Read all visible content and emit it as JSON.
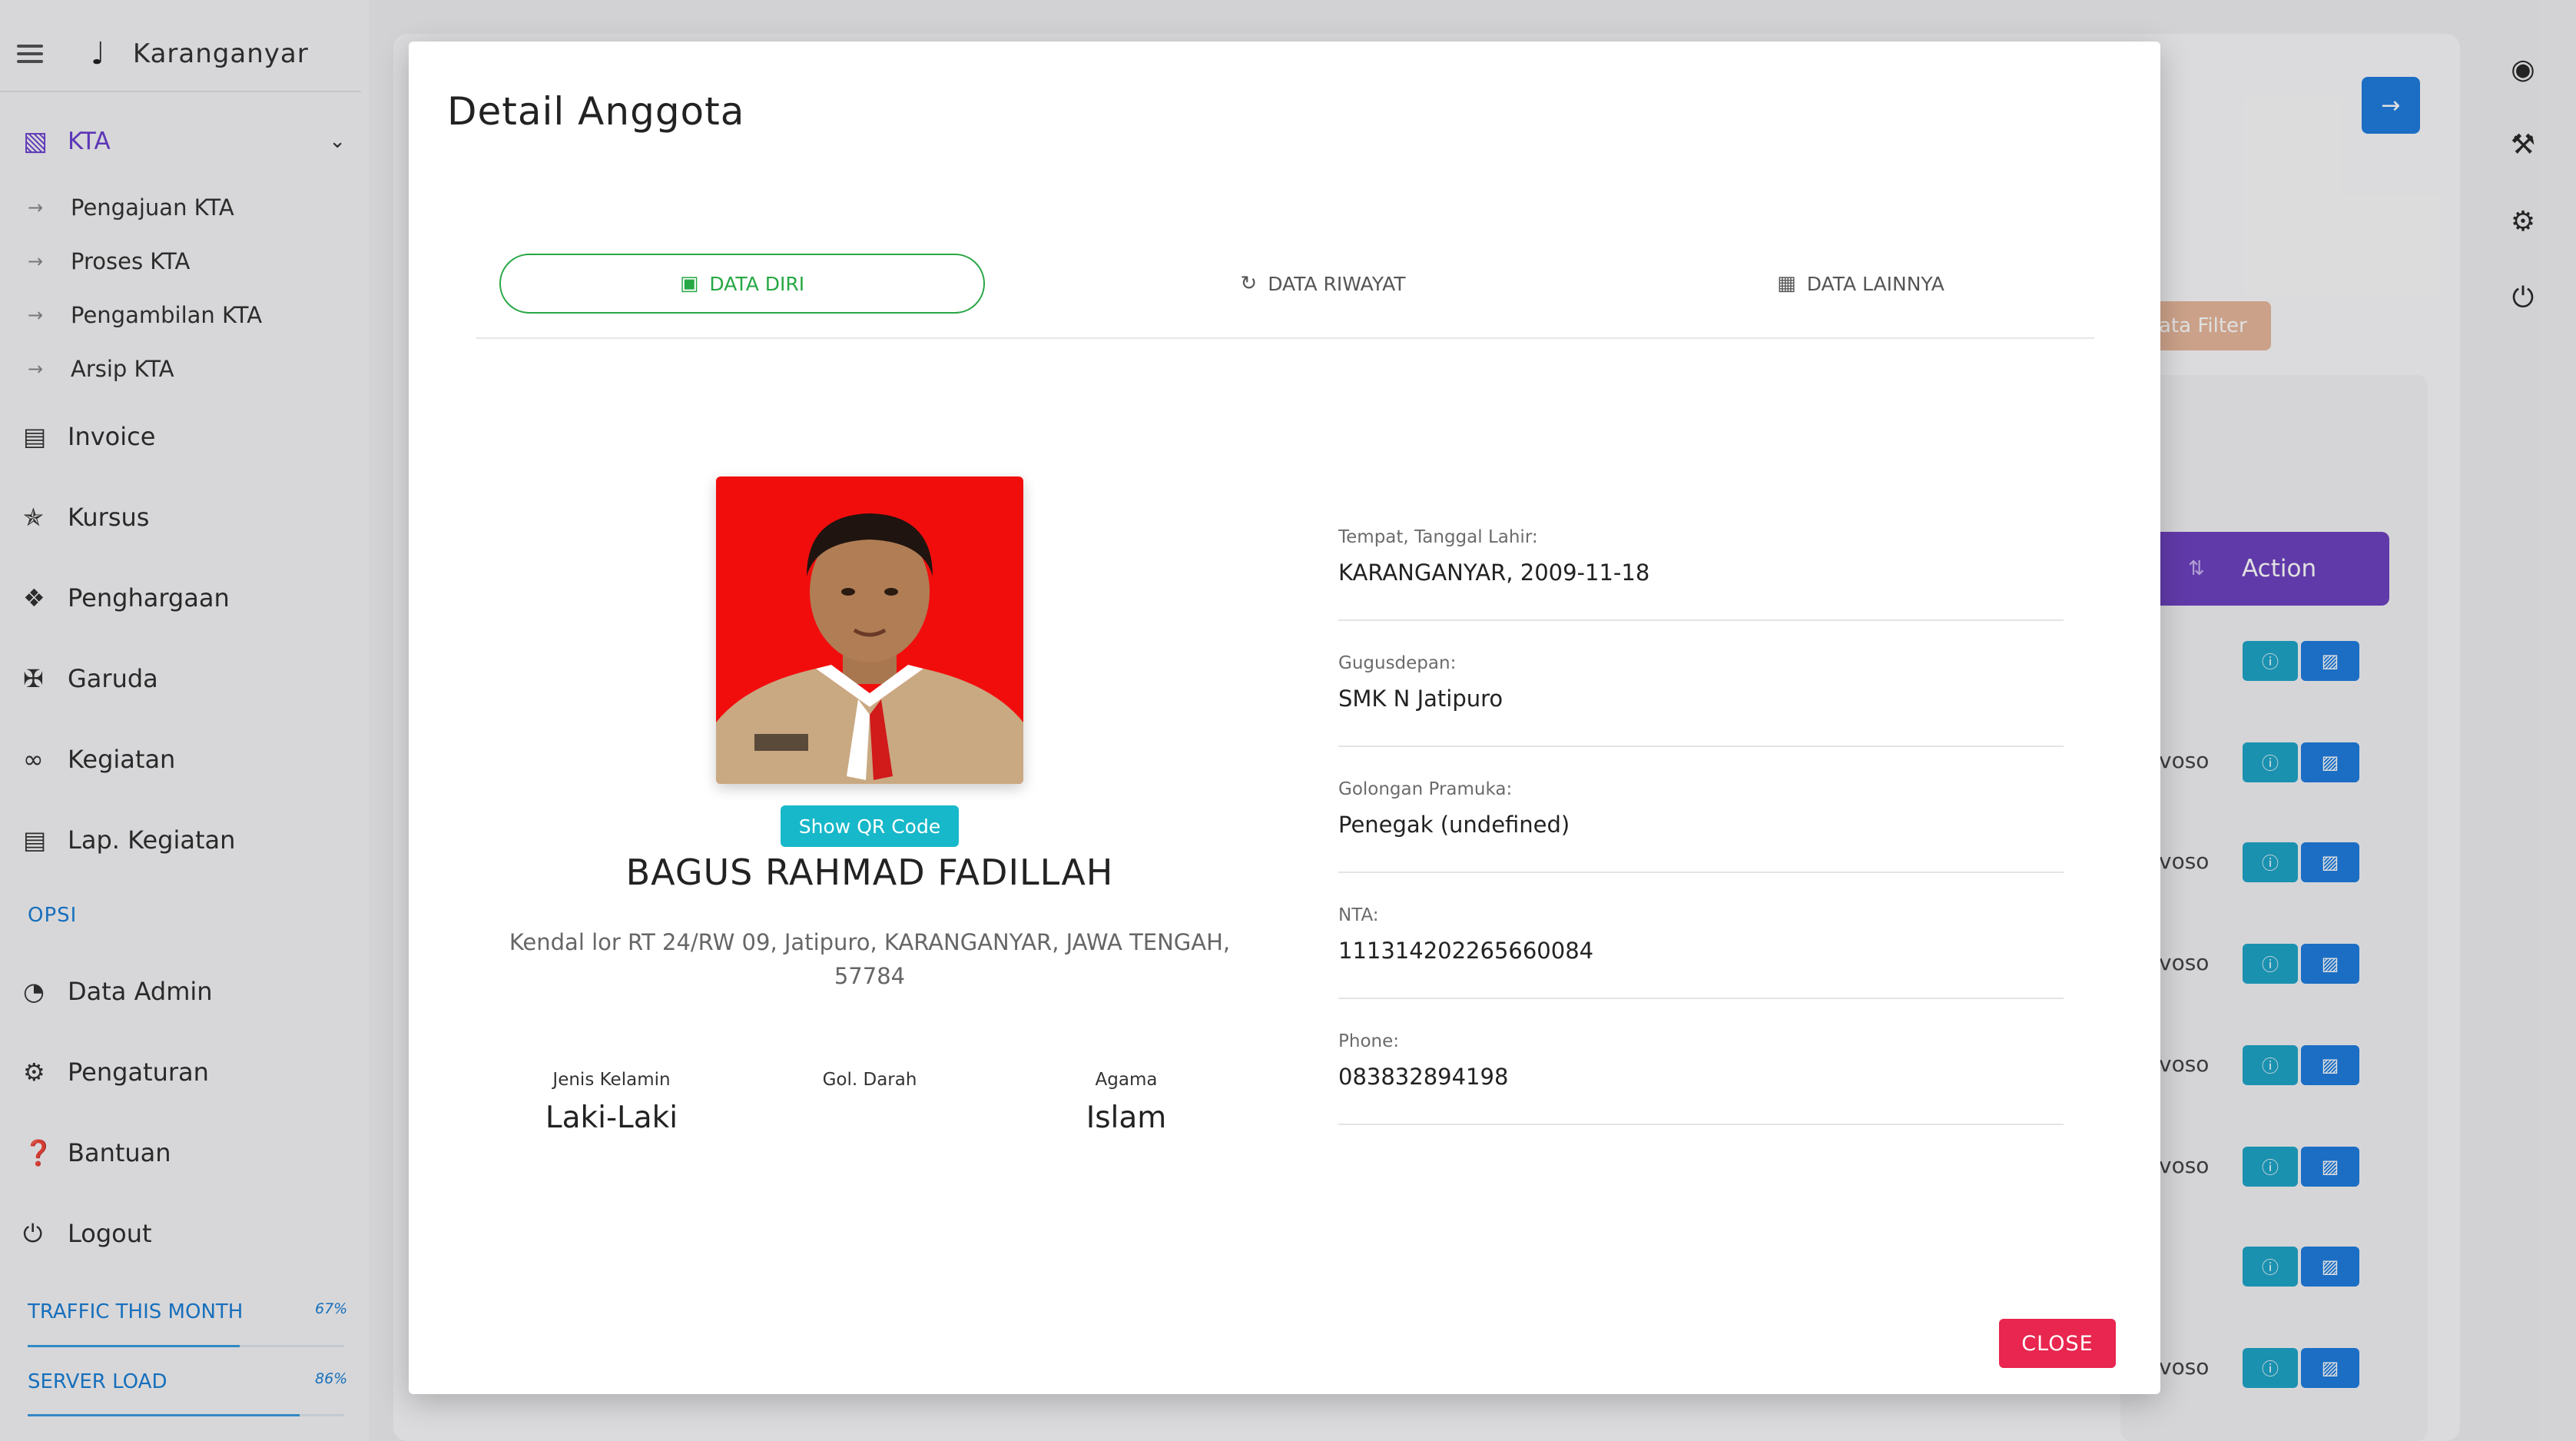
{
  "app": {
    "region": "Karanganyar"
  },
  "sidebar": {
    "kta": {
      "label": "KTA",
      "items": [
        "Pengajuan KTA",
        "Proses KTA",
        "Pengambilan KTA",
        "Arsip KTA"
      ]
    },
    "menu": [
      "Invoice",
      "Kursus",
      "Penghargaan",
      "Garuda",
      "Kegiatan",
      "Lap. Kegiatan"
    ],
    "opsi_label": "OPSI",
    "opsi_menu": [
      "Data Admin",
      "Pengaturan",
      "Bantuan",
      "Logout"
    ],
    "stats": [
      {
        "label": "TRAFFIC THIS MONTH",
        "pct_text": "67%",
        "value": 0.67
      },
      {
        "label": "SERVER LOAD",
        "pct_text": "86%",
        "value": 0.86
      }
    ]
  },
  "background": {
    "filter_label": "ata Filter",
    "action_header": "Action",
    "row_texts": [
      "voso",
      "voso",
      "voso",
      "voso",
      "voso",
      "voso"
    ]
  },
  "modal": {
    "title": "Detail Anggota",
    "tabs": [
      "DATA DIRI",
      "DATA RIWAYAT",
      "DATA LAINNYA"
    ],
    "qr_button": "Show QR Code",
    "name": "BAGUS RAHMAD FADILLAH",
    "address": "Kendal lor RT 24/RW 09, Jatipuro, KARANGANYAR, JAWA TENGAH, 57784",
    "attributes": [
      {
        "label": "Jenis Kelamin",
        "value": "Laki-Laki"
      },
      {
        "label": "Gol. Darah",
        "value": ""
      },
      {
        "label": "Agama",
        "value": "Islam"
      }
    ],
    "fields": [
      {
        "label": "Tempat, Tanggal Lahir:",
        "value": "KARANGANYAR, 2009-11-18"
      },
      {
        "label": "Gugusdepan:",
        "value": "SMK N Jatipuro"
      },
      {
        "label": "Golongan Pramuka:",
        "value": "Penegak (undefined)"
      },
      {
        "label": "NTA:",
        "value": "111314202265660084"
      },
      {
        "label": "Phone:",
        "value": "083832894198"
      }
    ],
    "close_button": "CLOSE"
  },
  "colors": {
    "accent": "#6f42c1",
    "active_tab": "#27a745",
    "close": "#e8264f",
    "qr": "#17b8c9",
    "link": "#1a7fd6"
  }
}
